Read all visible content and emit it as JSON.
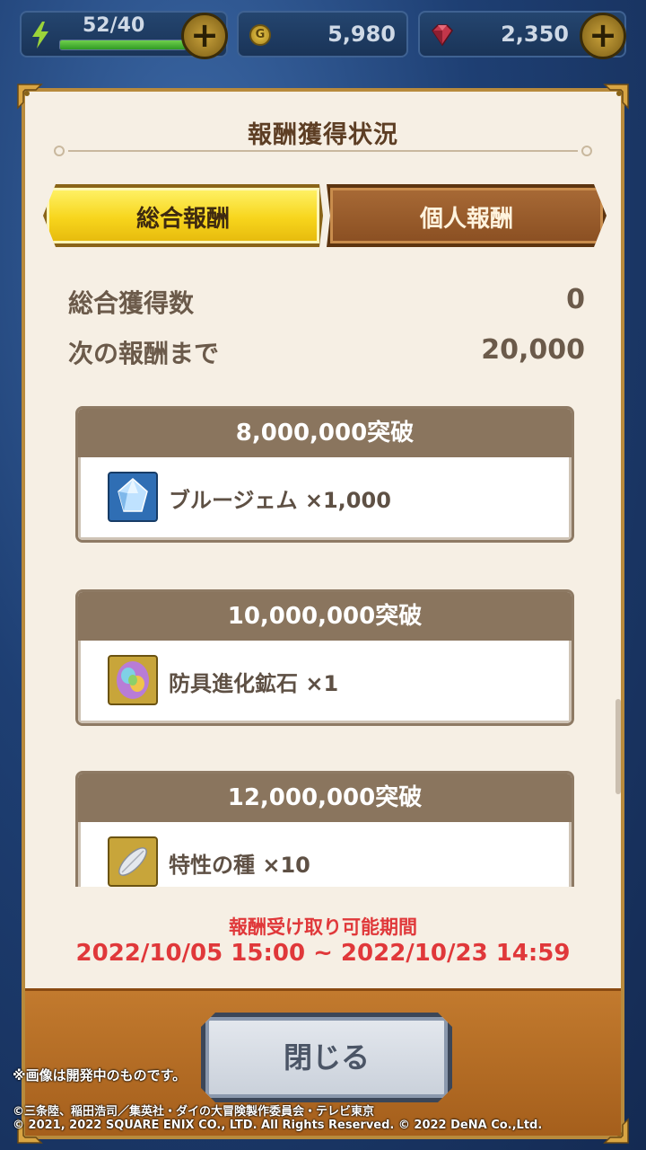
{
  "status": {
    "stamina": {
      "text": "52/40",
      "fill": 1.0
    },
    "gold": {
      "icon": "gold-coin-icon",
      "value": "5,980"
    },
    "gems": {
      "icon": "red-gem-icon",
      "value": "2,350"
    }
  },
  "panel": {
    "title": "報酬獲得状況",
    "tabs": [
      {
        "label": "総合報酬",
        "selected": true
      },
      {
        "label": "個人報酬",
        "selected": false
      }
    ],
    "summary": [
      {
        "label": "総合獲得数",
        "value": "0"
      },
      {
        "label": "次の報酬まで",
        "value": "20,000"
      }
    ],
    "rewards": [
      {
        "threshold": "8,000,000突破",
        "item": "ブルージェム ×1,000",
        "icon": "blue-gem-icon"
      },
      {
        "threshold": "10,000,000突破",
        "item": "防具進化鉱石 ×1",
        "icon": "armor-ore-icon"
      },
      {
        "threshold": "12,000,000突破",
        "item": "特性の種 ×10",
        "icon": "seed-icon"
      }
    ],
    "period": {
      "label": "報酬受け取り可能期間",
      "range": "2022/10/05 15:00 ~ 2022/10/23 14:59"
    },
    "close_label": "閉じる"
  },
  "footer_note": "※画像は開発中のものです。",
  "copyright": [
    "©三条陸、稲田浩司／集英社・ダイの大冒険製作委員会・テレビ東京",
    "© 2021, 2022 SQUARE ENIX CO., LTD. All Rights Reserved. © 2022 DeNA Co.,Ltd."
  ],
  "colors": {
    "accent_red": "#e0383a",
    "tab_active": "#f7d51c",
    "tab_inactive": "#8a4f22",
    "panel_bg": "#f6efe4"
  }
}
